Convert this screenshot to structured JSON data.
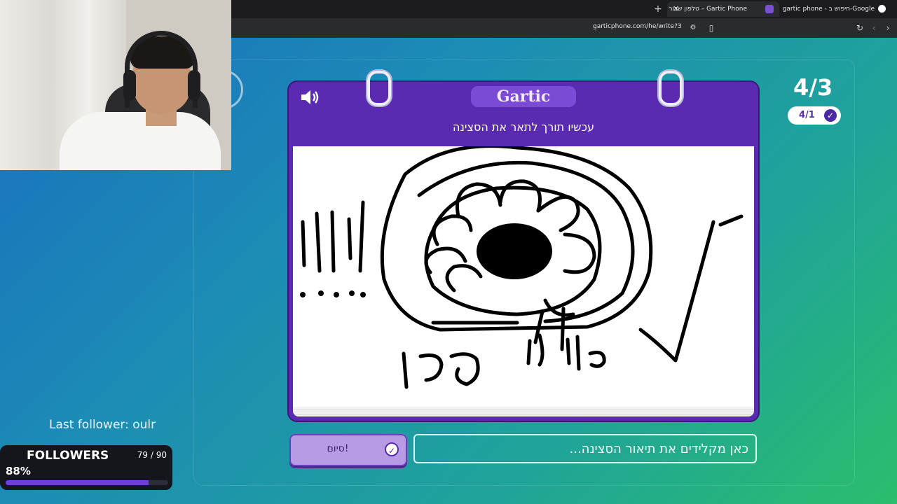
{
  "browser": {
    "tabs": [
      {
        "title": "טלפון שבור – Gartic Phone",
        "active": true
      },
      {
        "title": "gartic phone - חיפוש ב-Google",
        "active": false
      }
    ],
    "url": "garticphone.com/he/write?3"
  },
  "stream": {
    "last_follower": "Last follower: oulr",
    "followers_title": "FOLLOWERS",
    "followers_count": "79 / 90",
    "followers_percent_text": "88%",
    "followers_progress": 0.88,
    "accent_color": "#6f3fd6"
  },
  "game": {
    "round": "4/3",
    "players_done": "4/1",
    "logo": "Gartic",
    "prompt": "עכשיו תורך לתאר את הסצינה",
    "drawing_text": [
      "פרח",
      "זוג"
    ],
    "done_button": "סיום!",
    "input_placeholder": "כאן מקלידים את תיאור הסצינה...",
    "input_value": ""
  },
  "colors": {
    "card": "#5a2bb0",
    "button": "#b79be5"
  }
}
